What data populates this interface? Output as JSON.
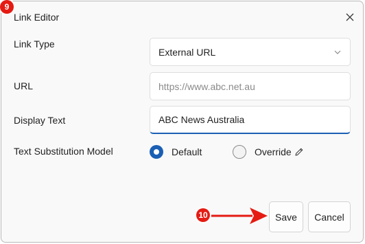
{
  "dialog": {
    "title": "Link Editor",
    "close_icon": "close-icon"
  },
  "badges": {
    "first": "9",
    "second": "10"
  },
  "form": {
    "link_type": {
      "label": "Link Type",
      "value": "External URL",
      "icon": "chevron-down-icon"
    },
    "url": {
      "label": "URL",
      "placeholder": "https://www.abc.net.au",
      "value": ""
    },
    "display_text": {
      "label": "Display Text",
      "value": "ABC News Australia"
    },
    "substitution": {
      "label": "Text Substitution Model",
      "options": [
        {
          "label": "Default",
          "selected": true
        },
        {
          "label": "Override",
          "selected": false,
          "icon": "pencil-icon"
        }
      ]
    }
  },
  "buttons": {
    "save": "Save",
    "cancel": "Cancel"
  },
  "colors": {
    "accent": "#1a5fb4",
    "badge": "#e51b13",
    "arrow": "#e51b13"
  }
}
